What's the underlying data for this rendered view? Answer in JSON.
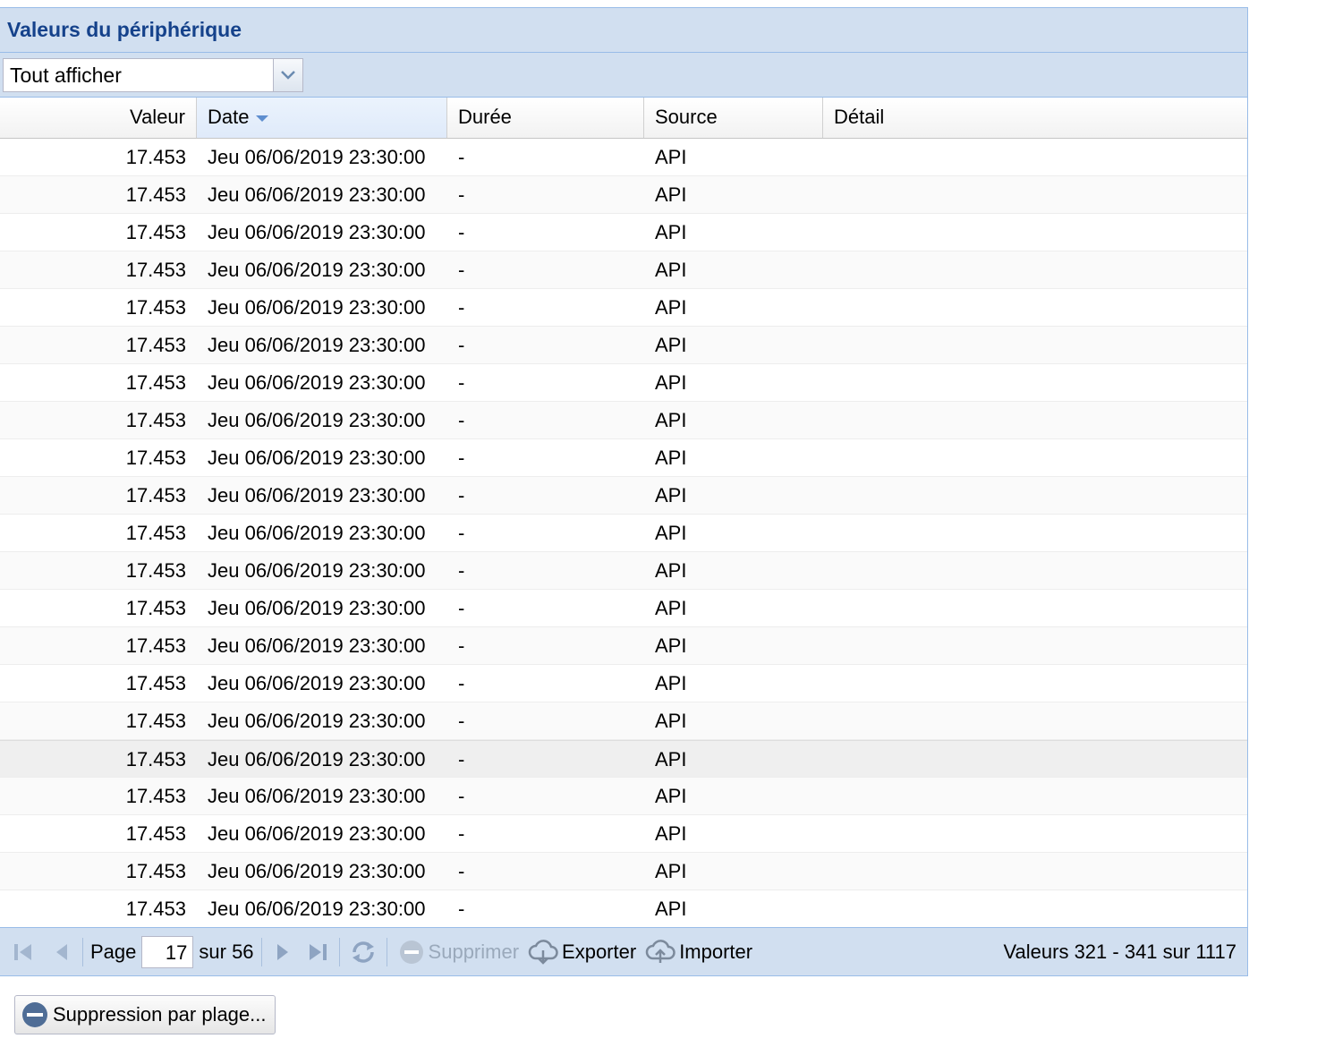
{
  "panel": {
    "title": "Valeurs du périphérique"
  },
  "filter": {
    "selected": "Tout afficher"
  },
  "columns": [
    {
      "label": "Valeur"
    },
    {
      "label": "Date",
      "sorted": "desc"
    },
    {
      "label": "Durée"
    },
    {
      "label": "Source"
    },
    {
      "label": "Détail"
    }
  ],
  "rows": [
    {
      "valeur": "17.453",
      "date": "Jeu 06/06/2019 23:30:00",
      "duree": "-",
      "source": "API",
      "detail": ""
    },
    {
      "valeur": "17.453",
      "date": "Jeu 06/06/2019 23:30:00",
      "duree": "-",
      "source": "API",
      "detail": ""
    },
    {
      "valeur": "17.453",
      "date": "Jeu 06/06/2019 23:30:00",
      "duree": "-",
      "source": "API",
      "detail": ""
    },
    {
      "valeur": "17.453",
      "date": "Jeu 06/06/2019 23:30:00",
      "duree": "-",
      "source": "API",
      "detail": ""
    },
    {
      "valeur": "17.453",
      "date": "Jeu 06/06/2019 23:30:00",
      "duree": "-",
      "source": "API",
      "detail": ""
    },
    {
      "valeur": "17.453",
      "date": "Jeu 06/06/2019 23:30:00",
      "duree": "-",
      "source": "API",
      "detail": ""
    },
    {
      "valeur": "17.453",
      "date": "Jeu 06/06/2019 23:30:00",
      "duree": "-",
      "source": "API",
      "detail": ""
    },
    {
      "valeur": "17.453",
      "date": "Jeu 06/06/2019 23:30:00",
      "duree": "-",
      "source": "API",
      "detail": ""
    },
    {
      "valeur": "17.453",
      "date": "Jeu 06/06/2019 23:30:00",
      "duree": "-",
      "source": "API",
      "detail": ""
    },
    {
      "valeur": "17.453",
      "date": "Jeu 06/06/2019 23:30:00",
      "duree": "-",
      "source": "API",
      "detail": ""
    },
    {
      "valeur": "17.453",
      "date": "Jeu 06/06/2019 23:30:00",
      "duree": "-",
      "source": "API",
      "detail": ""
    },
    {
      "valeur": "17.453",
      "date": "Jeu 06/06/2019 23:30:00",
      "duree": "-",
      "source": "API",
      "detail": ""
    },
    {
      "valeur": "17.453",
      "date": "Jeu 06/06/2019 23:30:00",
      "duree": "-",
      "source": "API",
      "detail": ""
    },
    {
      "valeur": "17.453",
      "date": "Jeu 06/06/2019 23:30:00",
      "duree": "-",
      "source": "API",
      "detail": ""
    },
    {
      "valeur": "17.453",
      "date": "Jeu 06/06/2019 23:30:00",
      "duree": "-",
      "source": "API",
      "detail": ""
    },
    {
      "valeur": "17.453",
      "date": "Jeu 06/06/2019 23:30:00",
      "duree": "-",
      "source": "API",
      "detail": ""
    },
    {
      "valeur": "17.453",
      "date": "Jeu 06/06/2019 23:30:00",
      "duree": "-",
      "source": "API",
      "detail": "",
      "hover": true
    },
    {
      "valeur": "17.453",
      "date": "Jeu 06/06/2019 23:30:00",
      "duree": "-",
      "source": "API",
      "detail": ""
    },
    {
      "valeur": "17.453",
      "date": "Jeu 06/06/2019 23:30:00",
      "duree": "-",
      "source": "API",
      "detail": ""
    },
    {
      "valeur": "17.453",
      "date": "Jeu 06/06/2019 23:30:00",
      "duree": "-",
      "source": "API",
      "detail": ""
    },
    {
      "valeur": "17.453",
      "date": "Jeu 06/06/2019 23:30:00",
      "duree": "-",
      "source": "API",
      "detail": ""
    }
  ],
  "paging": {
    "page_label": "Page",
    "page_value": "17",
    "of_label": "sur 56",
    "delete_label": "Supprimer",
    "export_label": "Exporter",
    "import_label": "Importer",
    "info": "Valeurs 321 - 341 sur 1117"
  },
  "range_delete": {
    "label": "Suppression par plage..."
  },
  "colors": {
    "panel_bg": "#d1dff0",
    "title": "#15428b",
    "border": "#99bce8"
  }
}
